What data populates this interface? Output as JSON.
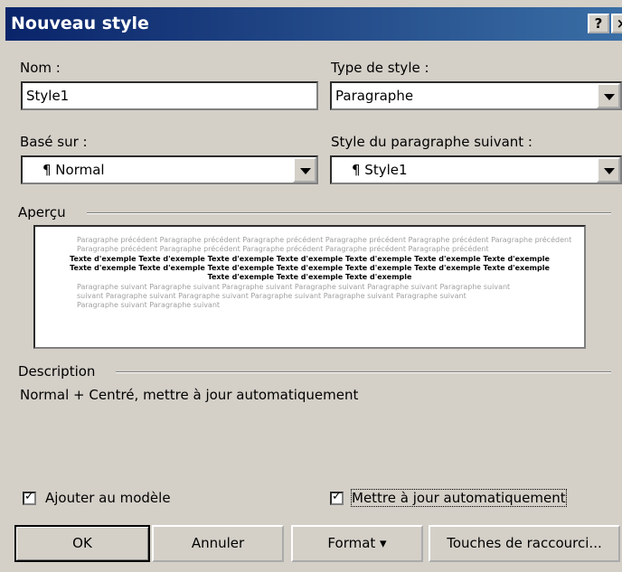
{
  "window": {
    "title": "Nouveau style",
    "help_glyph": "?",
    "close_glyph": "×"
  },
  "name_field": {
    "label": "Nom :",
    "value": "Style1"
  },
  "style_type": {
    "label": "Type de style :",
    "value": "Paragraphe"
  },
  "based_on": {
    "label": "Basé sur :",
    "value": "¶ Normal"
  },
  "next_style": {
    "label": "Style du paragraphe suivant :",
    "value": "¶ Style1"
  },
  "preview": {
    "label": "Aperçu",
    "prev_lines": [
      "Paragraphe précédent Paragraphe précédent Paragraphe précédent Paragraphe précédent Paragraphe précédent Paragraphe précédent",
      "Paragraphe précédent Paragraphe précédent Paragraphe précédent Paragraphe précédent Paragraphe précédent"
    ],
    "sample_lines": [
      "Texte d'exemple Texte d'exemple Texte d'exemple Texte d'exemple Texte d'exemple Texte d'exemple Texte d'exemple",
      "Texte d'exemple Texte d'exemple Texte d'exemple Texte d'exemple Texte d'exemple Texte d'exemple Texte d'exemple",
      "Texte d'exemple Texte d'exemple Texte d'exemple"
    ],
    "next_lines": [
      "Paragraphe suivant Paragraphe suivant Paragraphe suivant Paragraphe suivant Paragraphe suivant Paragraphe suivant",
      "suivant Paragraphe suivant Paragraphe suivant Paragraphe suivant Paragraphe suivant Paragraphe suivant",
      "Paragraphe suivant Paragraphe suivant"
    ]
  },
  "description": {
    "label": "Description",
    "text": "Normal + Centré, mettre à jour automatiquement"
  },
  "checkboxes": {
    "add_to_template": {
      "label": "Ajouter au modèle",
      "checked": true
    },
    "auto_update": {
      "label": "Mettre à jour automatiquement",
      "checked": true
    }
  },
  "buttons": {
    "ok": "OK",
    "cancel": "Annuler",
    "format": "Format ▾",
    "shortcut": "Touches de raccourci..."
  }
}
